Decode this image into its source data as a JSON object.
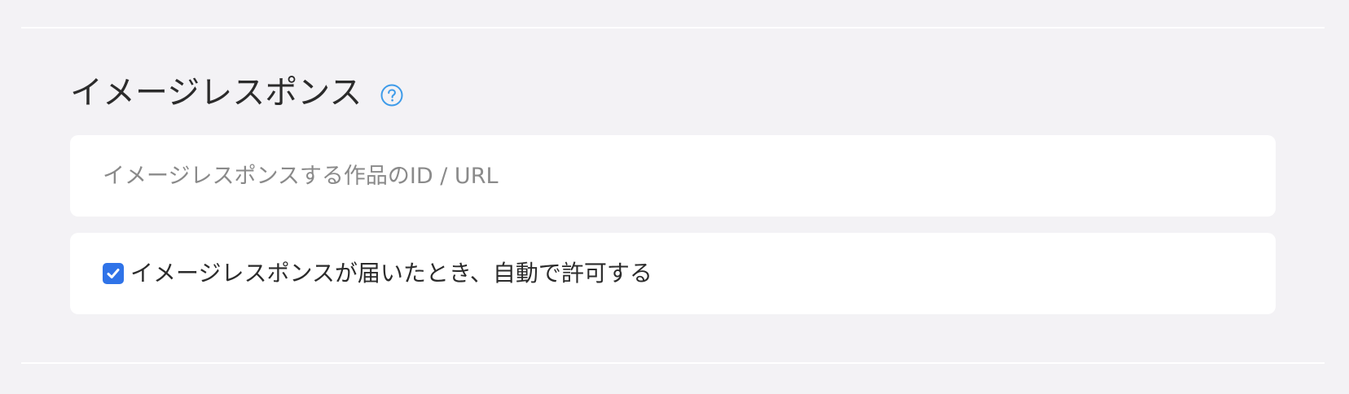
{
  "section": {
    "title": "イメージレスポンス",
    "help_icon": "question-circle-icon"
  },
  "response_input": {
    "value": "",
    "placeholder": "イメージレスポンスする作品のID / URL"
  },
  "auto_allow": {
    "checked": true,
    "label": "イメージレスポンスが届いたとき、自動で許可する"
  },
  "colors": {
    "background": "#f3f2f5",
    "card": "#ffffff",
    "accent": "#2f73e8",
    "help_icon": "#3d9be9",
    "text": "#2b2b2b",
    "placeholder": "#8a8a8a"
  }
}
